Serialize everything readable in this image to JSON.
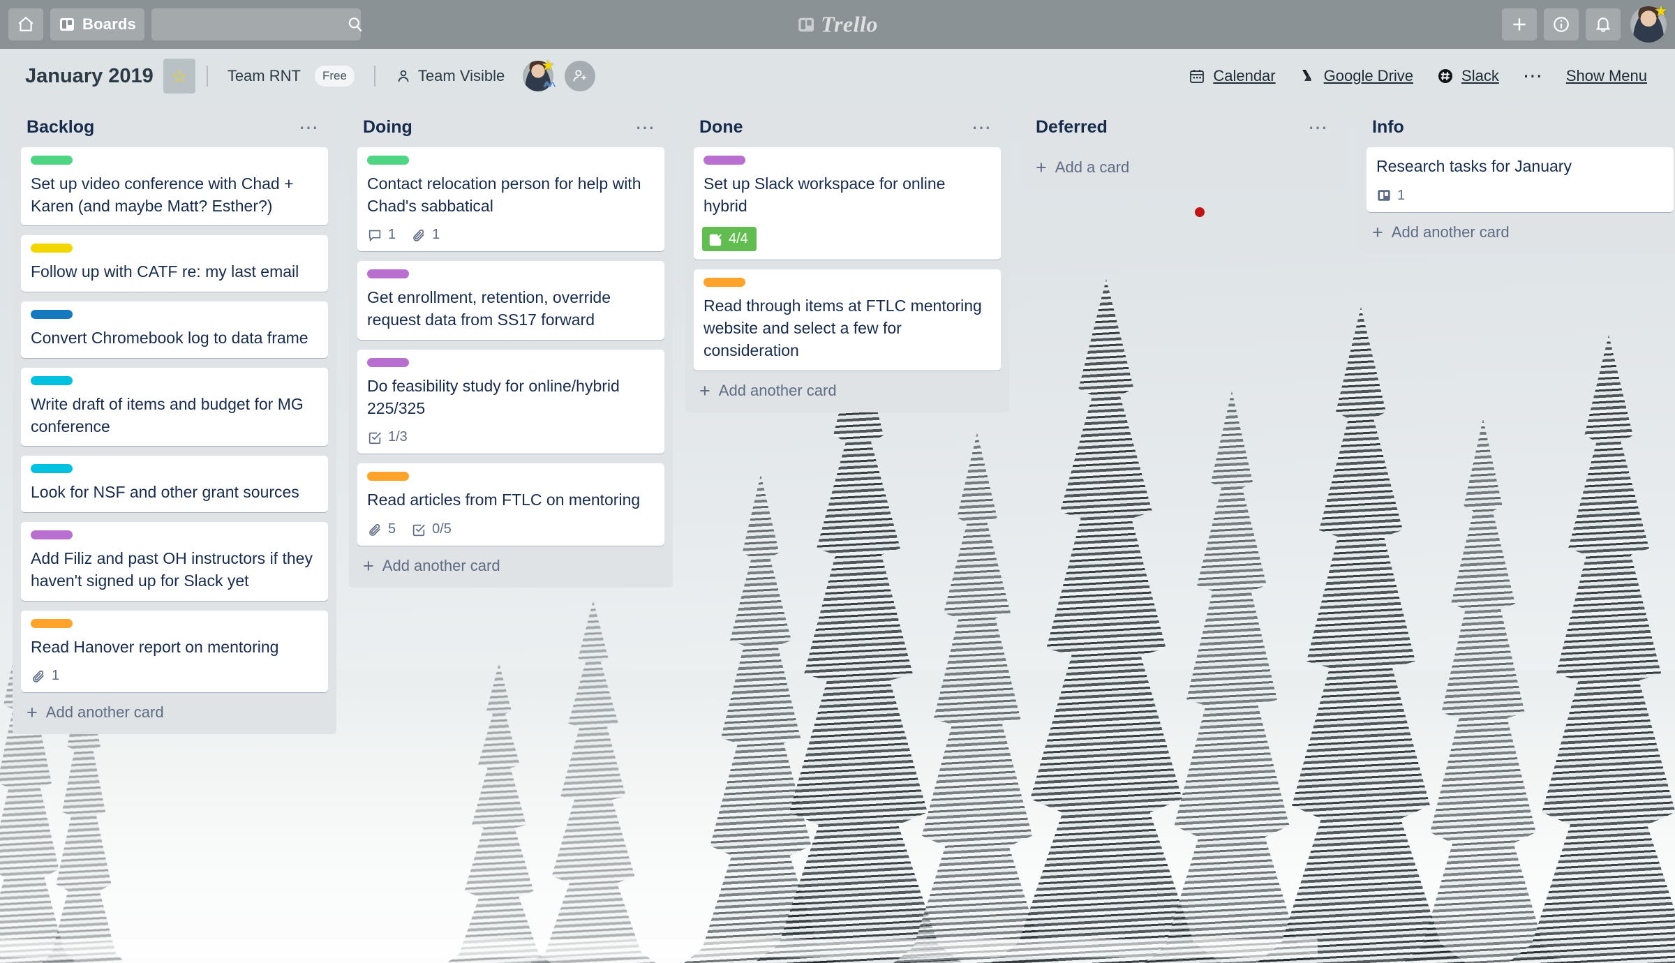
{
  "top_bar": {
    "home_icon": "home-icon",
    "boards_button": {
      "icon": "board-icon",
      "label": "Boards"
    },
    "search": {
      "icon": "search-icon",
      "value": "",
      "placeholder": ""
    },
    "logo": {
      "icon": "trello-board-icon",
      "wordmark": "Trello"
    },
    "actions": [
      {
        "name": "add-button",
        "icon": "plus-icon",
        "glyph": "+"
      },
      {
        "name": "info-button",
        "icon": "info-icon",
        "glyph": "i"
      },
      {
        "name": "notifications-button",
        "icon": "bell-icon",
        "glyph": "✉"
      }
    ],
    "avatar": {
      "icon": "avatar",
      "star_badge": "star-icon",
      "chevron_badge": "chevrons-up-icon"
    }
  },
  "board_header": {
    "title": "January 2019",
    "star_icon": "star-icon",
    "team_name": "Team RNT",
    "plan_badge": "Free",
    "visibility": {
      "icon": "person-icon",
      "label": "Team Visible"
    },
    "member_avatar": "avatar",
    "add_member_icon": "add-person-icon",
    "powerups": [
      {
        "name": "calendar-link",
        "icon": "calendar-icon",
        "label": "Calendar"
      },
      {
        "name": "google-drive-link",
        "icon": "google-drive-icon",
        "label": "Google Drive"
      },
      {
        "name": "slack-link",
        "icon": "slack-icon",
        "label": "Slack"
      }
    ],
    "more_icon": "ellipsis-icon",
    "show_menu_label": "Show Menu"
  },
  "colors": {
    "green": "#4ed583",
    "yellow": "#f2d600",
    "blue": "#1479bf",
    "sky": "#00c2e0",
    "purple": "#b86fd0",
    "orange": "#ffa32b",
    "complete_green": "#61bd4f",
    "list_bg": "#dfe3e6",
    "top_bar": "#8b9295",
    "cursor_dot": "#c11515"
  },
  "lists": [
    {
      "title": "Backlog",
      "menu_icon": "ellipsis-icon",
      "add_card_label": "Add another card",
      "cards": [
        {
          "labels": [
            "green"
          ],
          "title": "Set up video conference with Chad + Karen (and maybe Matt? Esther?)",
          "badges": []
        },
        {
          "labels": [
            "yellow"
          ],
          "title": "Follow up with CATF re: my last email",
          "badges": []
        },
        {
          "labels": [
            "blue"
          ],
          "title": "Convert Chromebook log to data frame",
          "badges": []
        },
        {
          "labels": [
            "sky"
          ],
          "title": "Write draft of items and budget for MG conference",
          "badges": []
        },
        {
          "labels": [
            "sky"
          ],
          "title": "Look for NSF and other grant sources",
          "badges": []
        },
        {
          "labels": [
            "purple"
          ],
          "title": "Add Filiz and past OH instructors if they haven't signed up for Slack yet",
          "badges": []
        },
        {
          "labels": [
            "orange"
          ],
          "title": "Read Hanover report on mentoring",
          "badges": [
            {
              "type": "attachment",
              "icon": "paperclip-icon",
              "text": "1"
            }
          ]
        }
      ]
    },
    {
      "title": "Doing",
      "menu_icon": "ellipsis-icon",
      "add_card_label": "Add another card",
      "cards": [
        {
          "labels": [
            "green"
          ],
          "title": "Contact relocation person for help with Chad's sabbatical",
          "badges": [
            {
              "type": "comment",
              "icon": "comment-icon",
              "text": "1"
            },
            {
              "type": "attachment",
              "icon": "paperclip-icon",
              "text": "1"
            }
          ]
        },
        {
          "labels": [
            "purple"
          ],
          "title": "Get enrollment, retention, override request data from SS17 forward",
          "badges": []
        },
        {
          "labels": [
            "purple"
          ],
          "title": "Do feasibility study for online/hybrid 225/325",
          "badges": [
            {
              "type": "checklist",
              "icon": "checklist-icon",
              "text": "1/3"
            }
          ]
        },
        {
          "labels": [
            "orange"
          ],
          "title": "Read articles from FTLC on mentoring",
          "badges": [
            {
              "type": "attachment",
              "icon": "paperclip-icon",
              "text": "5"
            },
            {
              "type": "checklist",
              "icon": "checklist-icon",
              "text": "0/5"
            }
          ]
        }
      ]
    },
    {
      "title": "Done",
      "menu_icon": "ellipsis-icon",
      "add_card_label": "Add another card",
      "cards": [
        {
          "labels": [
            "purple"
          ],
          "title": "Set up Slack workspace for online hybrid",
          "badges": [
            {
              "type": "checklist-complete",
              "icon": "checklist-icon",
              "text": "4/4"
            }
          ]
        },
        {
          "labels": [
            "orange"
          ],
          "title": "Read through items at FTLC mentoring website and select a few for consideration",
          "badges": []
        }
      ]
    },
    {
      "title": "Deferred",
      "menu_icon": "ellipsis-icon",
      "add_card_label": "Add a card",
      "cards": []
    },
    {
      "title": "Info",
      "menu_icon": "",
      "add_card_label": "Add another card",
      "cards": [
        {
          "labels": [],
          "title": "Research tasks for January",
          "badges": [
            {
              "type": "description",
              "icon": "board-icon",
              "text": "1"
            }
          ]
        }
      ]
    }
  ]
}
